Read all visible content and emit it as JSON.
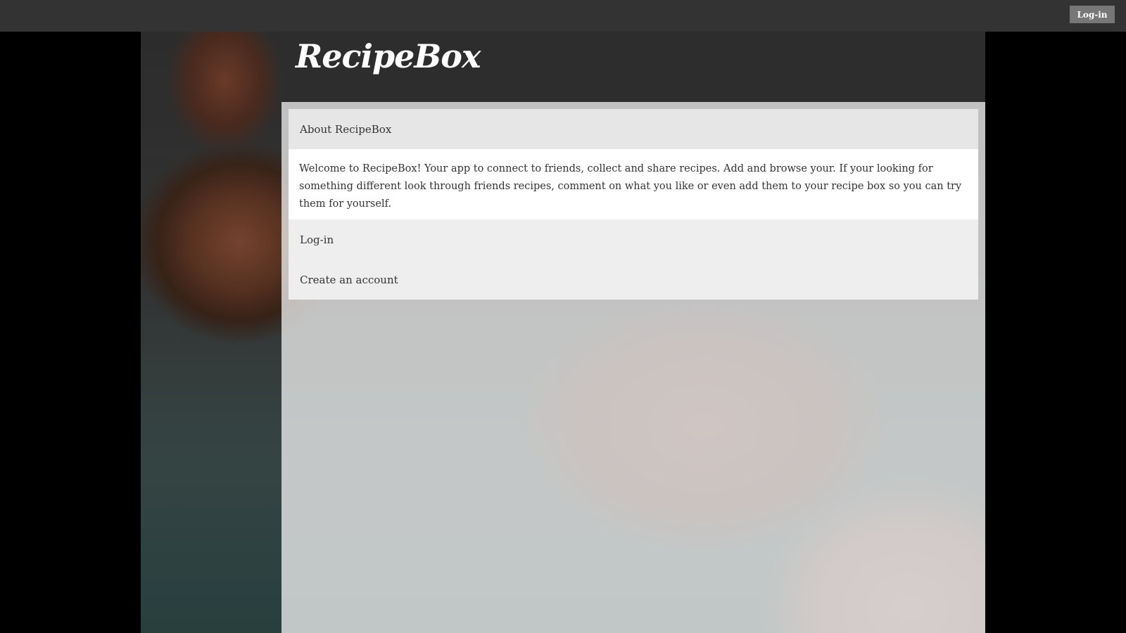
{
  "topbar": {
    "login_label": "Log-in"
  },
  "header": {
    "logo_text": "RecipeBox"
  },
  "about": {
    "heading": "About RecipeBox",
    "body": "Welcome to RecipeBox! Your app to connect to friends, collect and share recipes. Add and browse your. If your looking for something different look through friends recipes, comment on what you like or even add them to your recipe box so you can try them for yourself."
  },
  "menu": {
    "items": [
      {
        "label": "Log-in"
      },
      {
        "label": "Create an account"
      }
    ]
  }
}
